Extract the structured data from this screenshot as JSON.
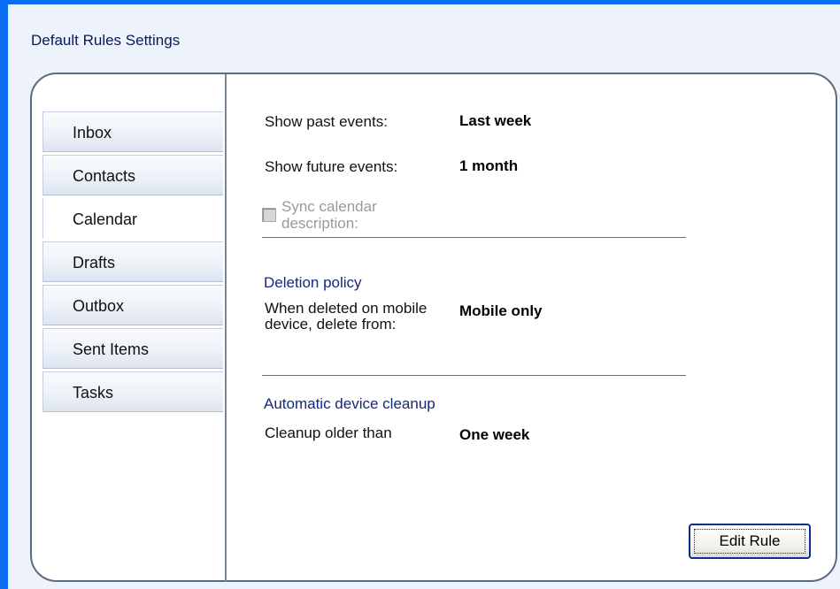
{
  "header": {
    "title": "Default Rules Settings"
  },
  "tabs": [
    {
      "label": "Inbox",
      "active": false
    },
    {
      "label": "Contacts",
      "active": false
    },
    {
      "label": "Calendar",
      "active": true
    },
    {
      "label": "Drafts",
      "active": false
    },
    {
      "label": "Outbox",
      "active": false
    },
    {
      "label": "Sent Items",
      "active": false
    },
    {
      "label": "Tasks",
      "active": false
    }
  ],
  "calendar": {
    "past_label": "Show past events:",
    "past_value": "Last week",
    "future_label": "Show future events:",
    "future_value": "1 month",
    "sync_label": "Sync calendar description:",
    "sync_checked": false,
    "sync_disabled": true
  },
  "deletion": {
    "heading": "Deletion policy",
    "label": "When deleted on mobile device, delete from:",
    "value": "Mobile only"
  },
  "cleanup": {
    "heading": "Automatic device cleanup",
    "label": "Cleanup older than",
    "value": "One week"
  },
  "actions": {
    "edit_label": "Edit Rule"
  },
  "colors": {
    "frame_blue": "#0a6cf0",
    "section_heading": "#15287d",
    "disabled_text": "#9a9a9a"
  }
}
